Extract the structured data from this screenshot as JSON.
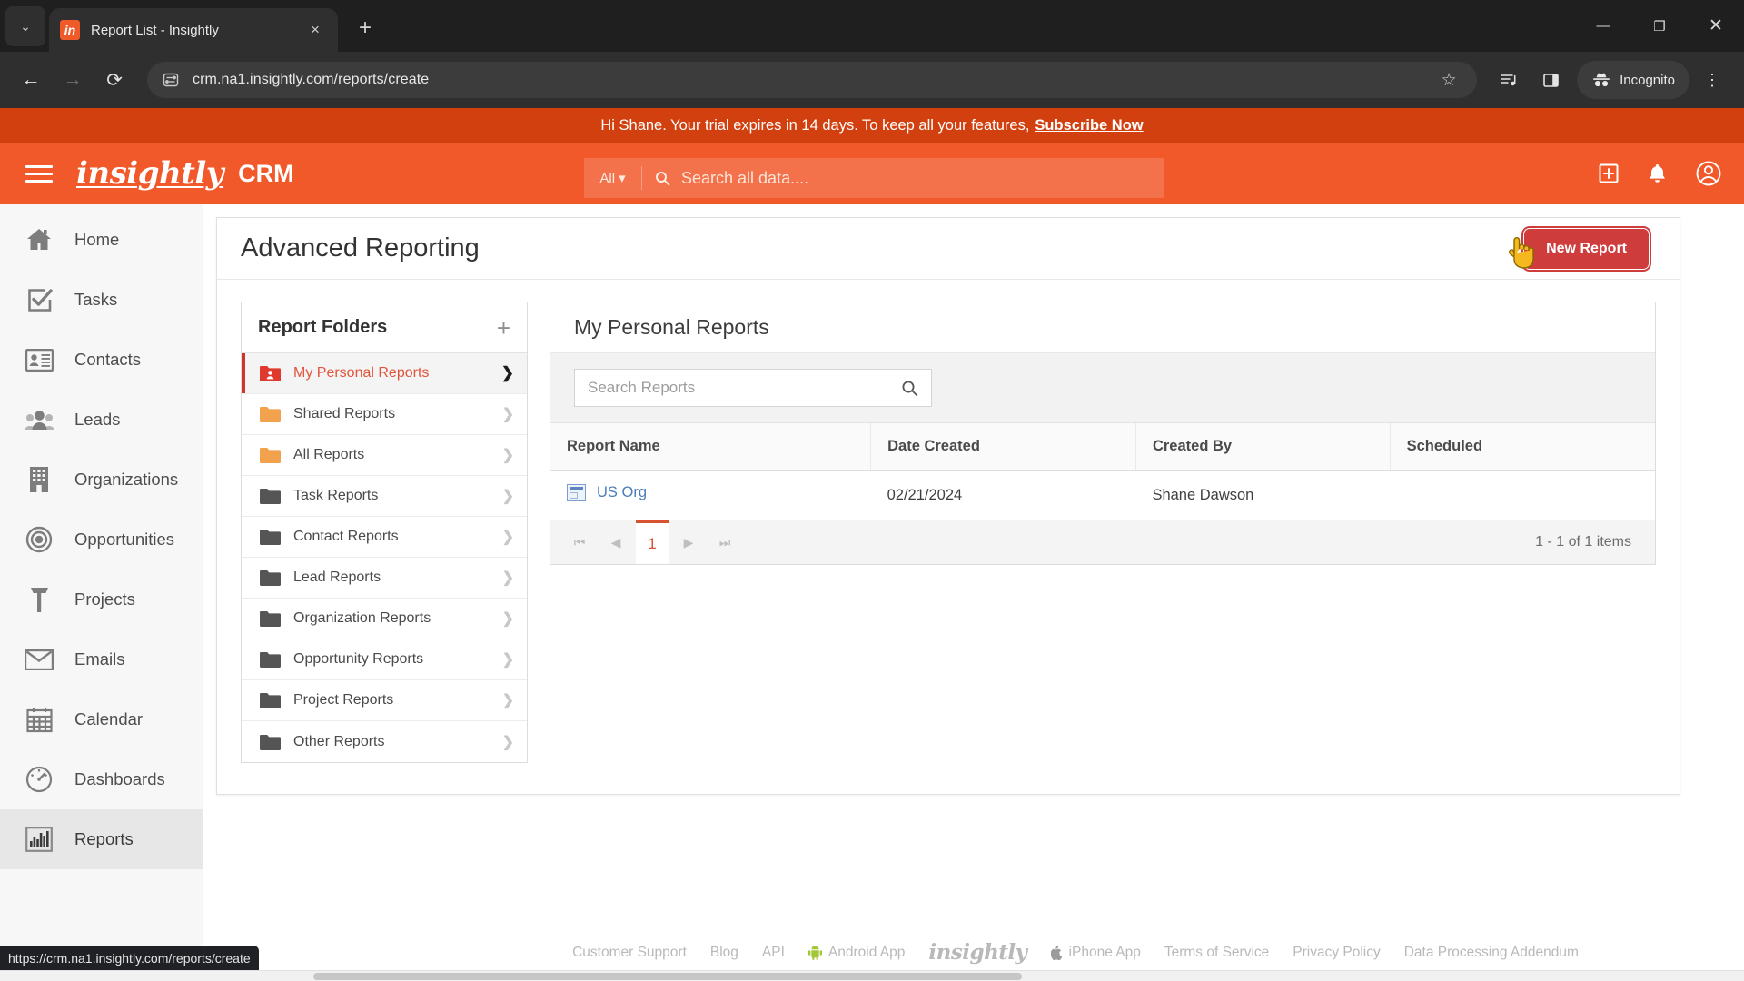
{
  "browser": {
    "tab": {
      "title": "Report List - Insightly",
      "favicon_text": "in",
      "favicon_name": "insightly-favicon"
    },
    "new_tab_label": "+",
    "tab_close_label": "×",
    "tab_list_chevron": "⌄",
    "window": {
      "minimize": "—",
      "maximize": "❐",
      "close": "✕"
    },
    "nav": {
      "back": "←",
      "forward": "→",
      "reload": "⟳"
    },
    "omnibox": {
      "url": "crm.na1.insightly.com/reports/create",
      "site_info_icon": "site-settings-icon",
      "star": "☆"
    },
    "toolbar_icons": [
      "reading-list-icon",
      "side-panel-icon"
    ],
    "incognito_label": "Incognito",
    "menu_icon": "⋮",
    "status_bar_url": "https://crm.na1.insightly.com/reports/create"
  },
  "banner": {
    "text": "Hi Shane. Your trial expires in 14 days. To keep all your features,",
    "link": "Subscribe Now"
  },
  "header": {
    "brand": "insightly",
    "product": "CRM",
    "search": {
      "scope": "All",
      "placeholder": "Search all data....",
      "scope_caret": "▾"
    },
    "actions": [
      "add-icon",
      "notifications-icon",
      "account-icon"
    ]
  },
  "sidebar": {
    "items": [
      {
        "label": "Home",
        "icon": "home-icon",
        "active": false
      },
      {
        "label": "Tasks",
        "icon": "tasks-icon",
        "active": false
      },
      {
        "label": "Contacts",
        "icon": "contacts-icon",
        "active": false
      },
      {
        "label": "Leads",
        "icon": "leads-icon",
        "active": false
      },
      {
        "label": "Organizations",
        "icon": "organizations-icon",
        "active": false
      },
      {
        "label": "Opportunities",
        "icon": "opportunities-icon",
        "active": false
      },
      {
        "label": "Projects",
        "icon": "projects-icon",
        "active": false
      },
      {
        "label": "Emails",
        "icon": "emails-icon",
        "active": false
      },
      {
        "label": "Calendar",
        "icon": "calendar-icon",
        "active": false
      },
      {
        "label": "Dashboards",
        "icon": "dashboards-icon",
        "active": false
      },
      {
        "label": "Reports",
        "icon": "reports-icon",
        "active": true
      }
    ]
  },
  "main": {
    "page_title": "Advanced Reporting",
    "new_report_button": "New Report",
    "new_report_highlight_color": "#cf3c3c",
    "folders": {
      "title": "Report Folders",
      "add_label": "+",
      "items": [
        {
          "label": "My Personal Reports",
          "folder_color": "red",
          "active": true
        },
        {
          "label": "Shared Reports",
          "folder_color": "orange",
          "active": false
        },
        {
          "label": "All Reports",
          "folder_color": "orange",
          "active": false
        },
        {
          "label": "Task Reports",
          "folder_color": "gray",
          "active": false
        },
        {
          "label": "Contact Reports",
          "folder_color": "gray",
          "active": false
        },
        {
          "label": "Lead Reports",
          "folder_color": "gray",
          "active": false
        },
        {
          "label": "Organization Reports",
          "folder_color": "gray",
          "active": false
        },
        {
          "label": "Opportunity Reports",
          "folder_color": "gray",
          "active": false
        },
        {
          "label": "Project Reports",
          "folder_color": "gray",
          "active": false
        },
        {
          "label": "Other Reports",
          "folder_color": "gray",
          "active": false
        }
      ]
    },
    "reports": {
      "title": "My Personal Reports",
      "search_placeholder": "Search Reports",
      "columns": [
        "Report Name",
        "Date Created",
        "Created By",
        "Scheduled"
      ],
      "rows": [
        {
          "name": "US Org",
          "date_created": "02/21/2024",
          "created_by": "Shane Dawson",
          "scheduled": ""
        }
      ],
      "pager": {
        "first": "⏮",
        "prev": "◀",
        "page": "1",
        "next": "▶",
        "last": "⏭",
        "count": "1 - 1 of 1 items"
      }
    }
  },
  "footer": {
    "links": [
      "Customer Support",
      "Blog",
      "API",
      "Android App",
      "insightly",
      "iPhone App",
      "Terms of Service",
      "Privacy Policy",
      "Data Processing Addendum"
    ]
  },
  "colors": {
    "brand_orange": "#f1582a",
    "banner_red": "#d2400f",
    "accent_red": "#d0342c",
    "link_blue": "#4a7ebb",
    "folder_orange": "#f2a14c",
    "folder_gray": "#555555"
  }
}
